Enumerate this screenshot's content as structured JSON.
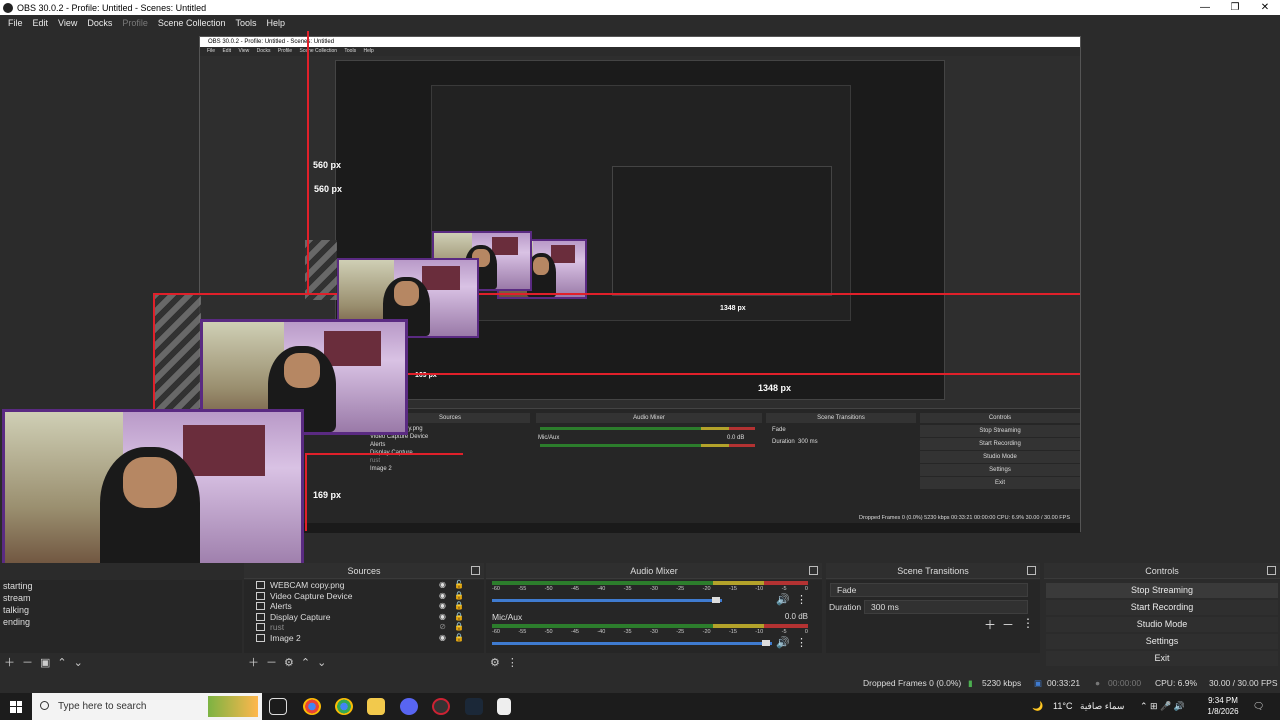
{
  "window": {
    "title": "OBS 30.0.2 - Profile: Untitled - Scenes: Untitled",
    "controls": [
      "—",
      "❐",
      "✕"
    ]
  },
  "menu": [
    "File",
    "Edit",
    "View",
    "Docks",
    "Profile",
    "Scene Collection",
    "Tools",
    "Help"
  ],
  "preview": {
    "measure_560": "560 px",
    "measure_1348": "1348 px",
    "measure_169": "169 px",
    "nested_title": "OBS 30.0.2 - Profile: Untitled - Scenes: Untitled",
    "nested_measure_1348": "1348 px",
    "nested_measure_169": "169 px",
    "nested_measure_560": "560 px"
  },
  "nested_docks": {
    "sources_title": "Sources",
    "mixer_title": "Audio Mixer",
    "transitions_title": "Scene Transitions",
    "controls_title": "Controls",
    "sources": [
      "WEBCAM copy.png",
      "Video Capture Device",
      "Alerts",
      "Display Capture",
      "rust",
      "Image 2"
    ],
    "controls": [
      "Stop Streaming",
      "Start Recording",
      "Studio Mode",
      "Settings",
      "Exit"
    ],
    "fade": "Fade",
    "duration_label": "Duration",
    "duration_value": "300 ms",
    "mic_label": "Mic/Aux",
    "mic_db": "0.0 dB",
    "status": "Dropped Frames 0 (0.0%)   5230 kbps   00:33:21   00:00:00   CPU: 6.9%   30.00 / 30.00 FPS"
  },
  "scenes": {
    "items": [
      "starting",
      "stream",
      "talking",
      "ending"
    ]
  },
  "sources": {
    "title": "Sources",
    "items": [
      {
        "name": "WEBCAM copy.png",
        "dim": false
      },
      {
        "name": "Video Capture Device",
        "dim": false
      },
      {
        "name": "Alerts",
        "dim": false
      },
      {
        "name": "Display Capture",
        "dim": false
      },
      {
        "name": "rust",
        "dim": true
      },
      {
        "name": "Image 2",
        "dim": false
      }
    ]
  },
  "mixer": {
    "title": "Audio Mixer",
    "scale": [
      "-60",
      "-55",
      "-50",
      "-45",
      "-40",
      "-35",
      "-30",
      "-25",
      "-20",
      "-15",
      "-10",
      "-5",
      "0"
    ],
    "channel2_name": "Mic/Aux",
    "channel2_db": "0.0 dB"
  },
  "transitions": {
    "title": "Scene Transitions",
    "selected": "Fade",
    "duration_label": "Duration",
    "duration_value": "300 ms"
  },
  "controls": {
    "title": "Controls",
    "buttons": [
      "Stop Streaming",
      "Start Recording",
      "Studio Mode",
      "Settings",
      "Exit"
    ]
  },
  "status": {
    "dropped": "Dropped Frames 0 (0.0%)",
    "kbps": "5230 kbps",
    "stream_time": "00:33:21",
    "rec_time": "00:00:00",
    "cpu": "CPU: 6.9%",
    "fps": "30.00 / 30.00 FPS"
  },
  "taskbar": {
    "search_placeholder": "Type here to search",
    "weather_temp": "11°C",
    "weather_desc": "سماء صافية",
    "time": "9:34 PM",
    "date": "1/8/2026"
  },
  "colors": {
    "accent": "#e0202a",
    "webcam_border": "#5a2a82",
    "slider": "#3f7bd0"
  }
}
